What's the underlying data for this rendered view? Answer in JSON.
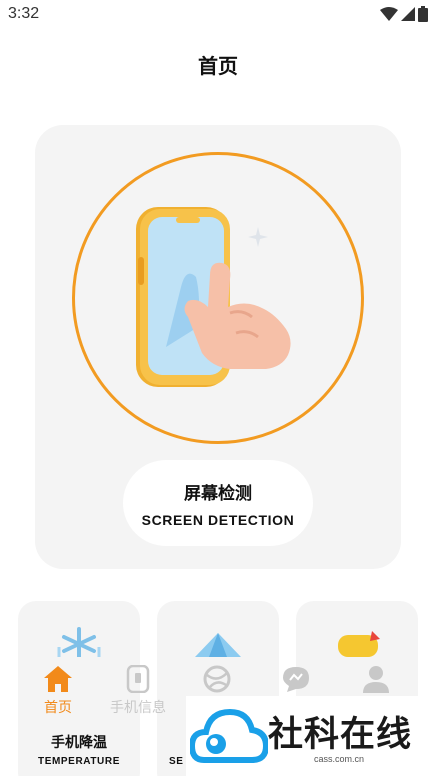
{
  "status": {
    "time": "3:32"
  },
  "page": {
    "title": "首页"
  },
  "hero": {
    "title": "屏幕检测",
    "subtitle": "SCREEN DETECTION"
  },
  "features": [
    {
      "title": "手机降温",
      "subtitle": "TEMPERATURE",
      "icon": "snowflake-icon"
    },
    {
      "title": "",
      "subtitle": "SE",
      "icon": "crystal-icon"
    },
    {
      "title": "",
      "subtitle": "",
      "icon": "yellow-object-icon"
    }
  ],
  "nav": [
    {
      "label": "首页",
      "icon": "home-icon",
      "active": true
    },
    {
      "label": "手机信息",
      "icon": "phone-info-icon",
      "active": false
    },
    {
      "label": "",
      "icon": "globe-icon",
      "active": false
    },
    {
      "label": "",
      "icon": "chat-icon",
      "active": false
    },
    {
      "label": "",
      "icon": "user-icon",
      "active": false
    }
  ],
  "watermark": {
    "text": "社科在线",
    "url": "cass.com.cn"
  },
  "colors": {
    "accent": "#f29b21",
    "nav_active": "#f28a1a",
    "nav_inactive": "#c8c8c8",
    "card_bg": "#f4f4f4"
  }
}
